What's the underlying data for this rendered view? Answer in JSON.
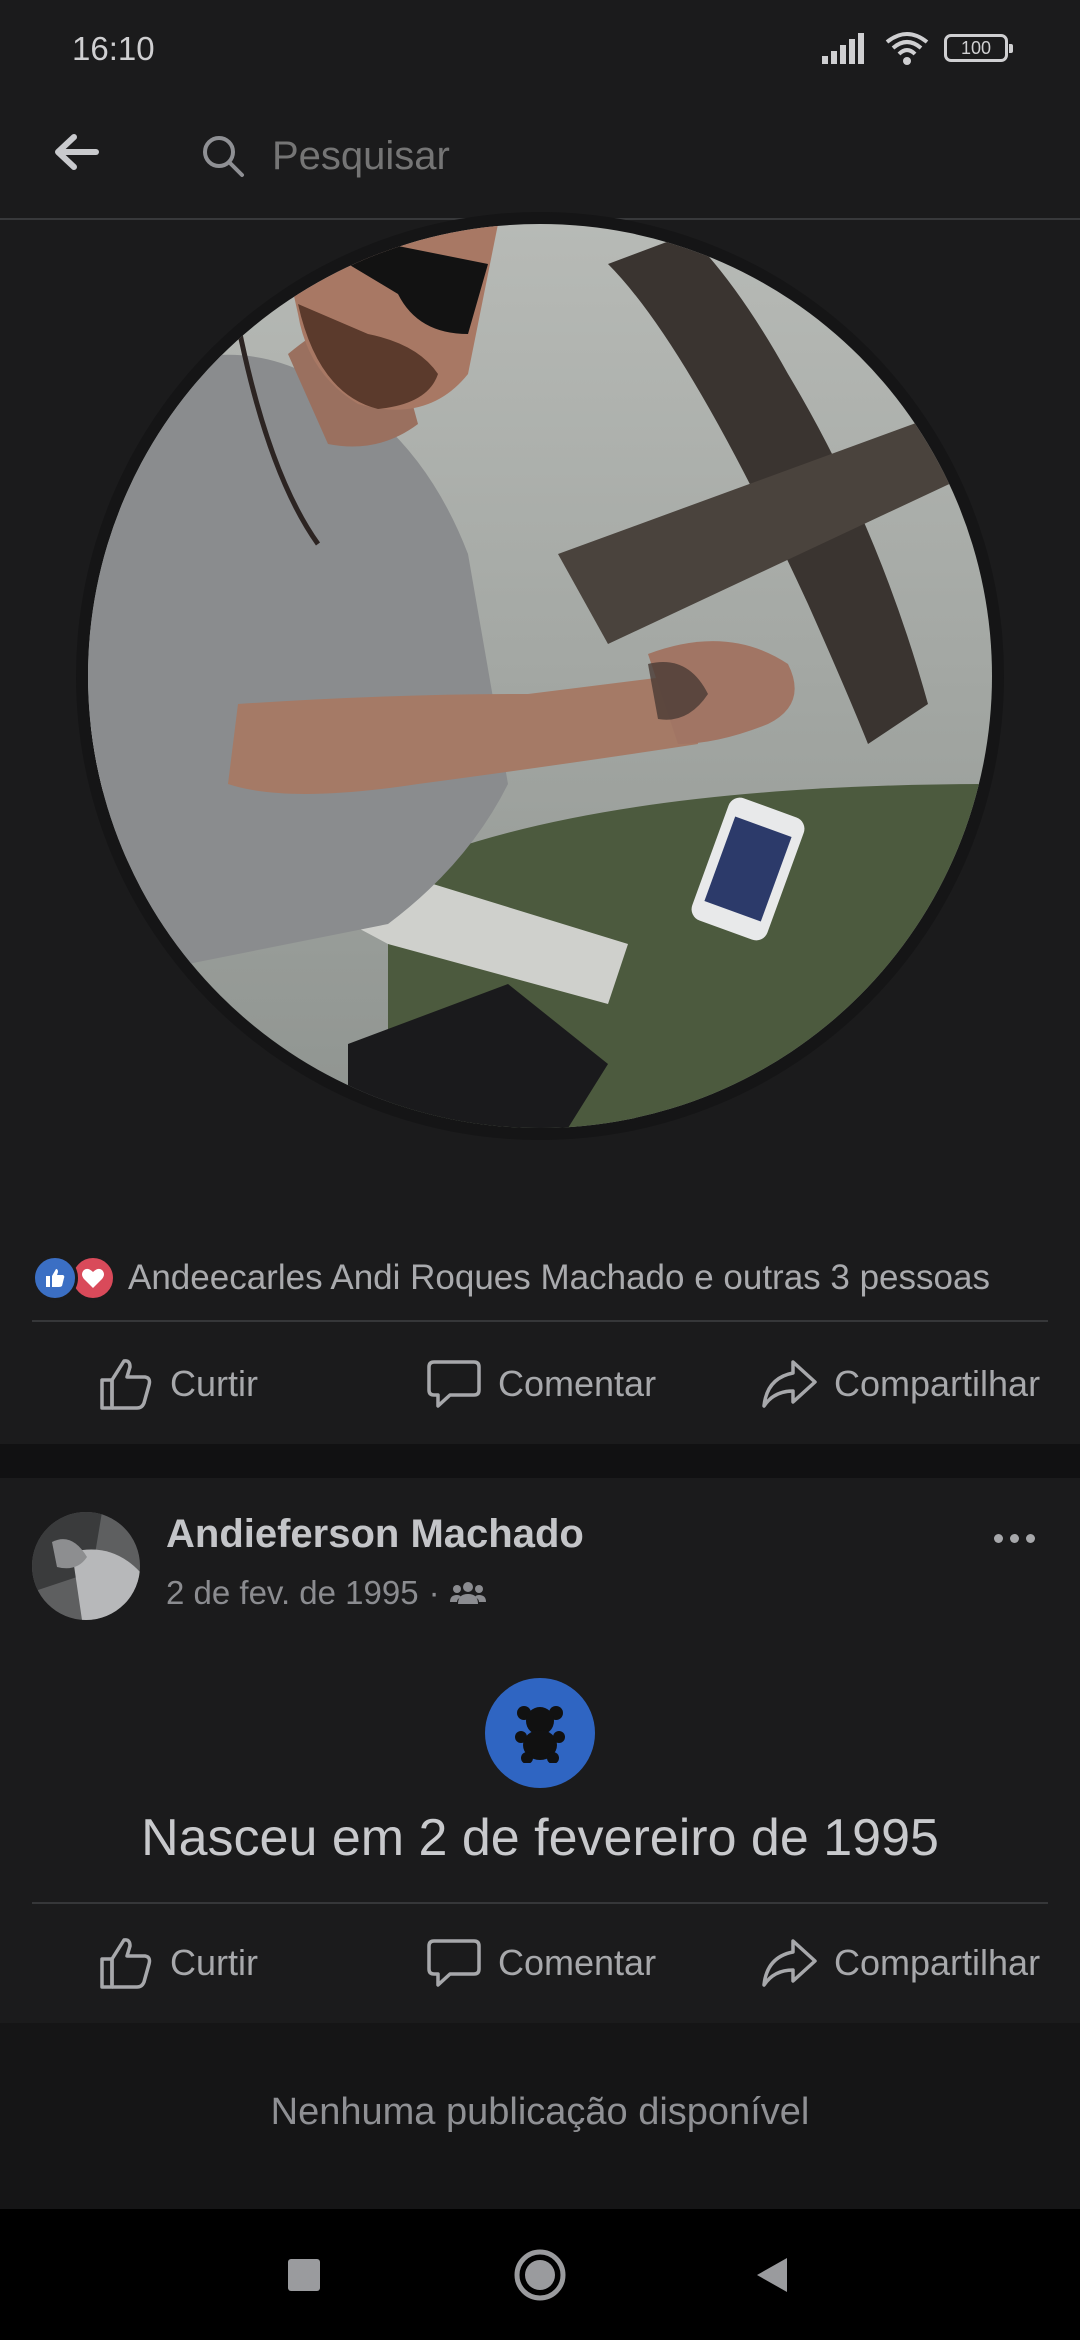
{
  "status_bar": {
    "time": "16:10",
    "battery": "100"
  },
  "search": {
    "placeholder": "Pesquisar"
  },
  "profile_post": {
    "reactions_text": "Andeecarles Andi Roques Machado e outras 3 pessoas",
    "actions": {
      "like": "Curtir",
      "comment": "Comentar",
      "share": "Compartilhar"
    }
  },
  "life_event_post": {
    "author": "Andieferson Machado",
    "date": "2 de fev. de 1995",
    "separator": "·",
    "title": "Nasceu em 2 de fevereiro de 1995",
    "actions": {
      "like": "Curtir",
      "comment": "Comentar",
      "share": "Compartilhar"
    }
  },
  "empty_state": {
    "text": "Nenhuma publicação disponível"
  },
  "colors": {
    "background": "#1b1b1c",
    "like_blue": "#3b6fc4",
    "love_red": "#d94a5a",
    "event_blue": "#2f65c2"
  }
}
